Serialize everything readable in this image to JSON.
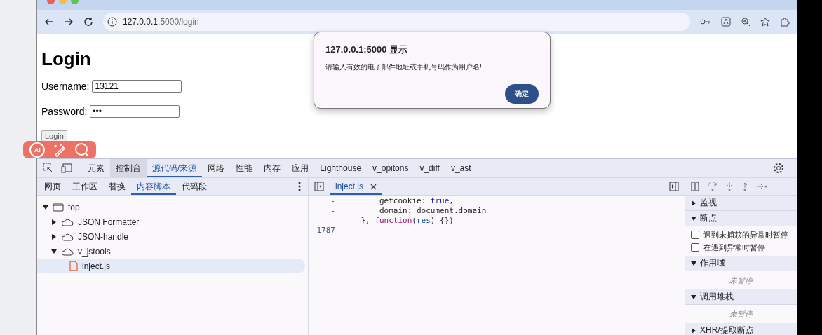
{
  "browser": {
    "url_host": "127.0.0.1",
    "url_rest": ":5000/login"
  },
  "page": {
    "heading": "Login",
    "fields": [
      {
        "label": "Username:",
        "value": "13121"
      },
      {
        "label": "Password:",
        "value": "•••"
      }
    ],
    "button": "Login"
  },
  "floating_toolbar": {
    "ai_label": "AI"
  },
  "dialog": {
    "title": "127.0.0.1:5000 显示",
    "message": "请输入有效的电子邮件地址或手机号码作为用户名!",
    "button": "确定"
  },
  "devtools": {
    "tabs": [
      {
        "label": "元素",
        "selected": false,
        "hovered": false
      },
      {
        "label": "控制台",
        "selected": false,
        "hovered": true
      },
      {
        "label": "源代码/来源",
        "selected": true,
        "hovered": false
      },
      {
        "label": "网络",
        "selected": false,
        "hovered": false
      },
      {
        "label": "性能",
        "selected": false,
        "hovered": false
      },
      {
        "label": "内存",
        "selected": false,
        "hovered": false
      },
      {
        "label": "应用",
        "selected": false,
        "hovered": false
      },
      {
        "label": "Lighthouse",
        "selected": false,
        "hovered": false
      },
      {
        "label": "v_opitons",
        "selected": false,
        "hovered": false
      },
      {
        "label": "v_diff",
        "selected": false,
        "hovered": false
      },
      {
        "label": "v_ast",
        "selected": false,
        "hovered": false
      }
    ],
    "subtabs": [
      {
        "label": "网页",
        "selected": false
      },
      {
        "label": "工作区",
        "selected": false
      },
      {
        "label": "替换",
        "selected": false
      },
      {
        "label": "内容脚本",
        "selected": true
      },
      {
        "label": "代码段",
        "selected": false
      }
    ],
    "tree": [
      {
        "label": "top",
        "kind": "frame",
        "expanded": true,
        "selected": false,
        "children": [
          {
            "label": "JSON Formatter",
            "kind": "extension",
            "expanded": false,
            "selected": false
          },
          {
            "label": "JSON-handle",
            "kind": "extension",
            "expanded": false,
            "selected": false
          },
          {
            "label": "v_jstools",
            "kind": "extension",
            "expanded": true,
            "selected": false,
            "children": [
              {
                "label": "inject.js",
                "kind": "file",
                "selected": true
              }
            ]
          }
        ]
      }
    ],
    "editor_tab": {
      "label": "inject.js",
      "selected": true
    },
    "code": [
      {
        "gutter": "-",
        "tokens": [
          {
            "kind": "plain",
            "text": "        getcookie: "
          },
          {
            "kind": "literal",
            "text": "true"
          },
          {
            "kind": "plain",
            "text": ","
          }
        ]
      },
      {
        "gutter": "-",
        "tokens": [
          {
            "kind": "plain",
            "text": "        domain: document.domain"
          }
        ]
      },
      {
        "gutter": "-",
        "tokens": [
          {
            "kind": "plain",
            "text": "    }, "
          },
          {
            "kind": "keyword",
            "text": "function"
          },
          {
            "kind": "plain",
            "text": "("
          },
          {
            "kind": "param",
            "text": "res"
          },
          {
            "kind": "plain",
            "text": ") {})"
          }
        ]
      },
      {
        "gutter": "1787"
      }
    ],
    "sidebar": [
      {
        "title": "监视",
        "expanded": false,
        "kind": "header"
      },
      {
        "title": "断点",
        "expanded": true,
        "kind": "checkboxes",
        "items": [
          {
            "label": "遇到未捕获的异常时暂停",
            "checked": false
          },
          {
            "label": "在遇到异常时暂停",
            "checked": false
          }
        ]
      },
      {
        "title": "作用域",
        "expanded": true,
        "kind": "note",
        "note": "未暂停"
      },
      {
        "title": "调用堆栈",
        "expanded": true,
        "kind": "note",
        "note": "未暂停"
      },
      {
        "title": "XHR/提取断点",
        "expanded": false,
        "kind": "header"
      }
    ]
  }
}
